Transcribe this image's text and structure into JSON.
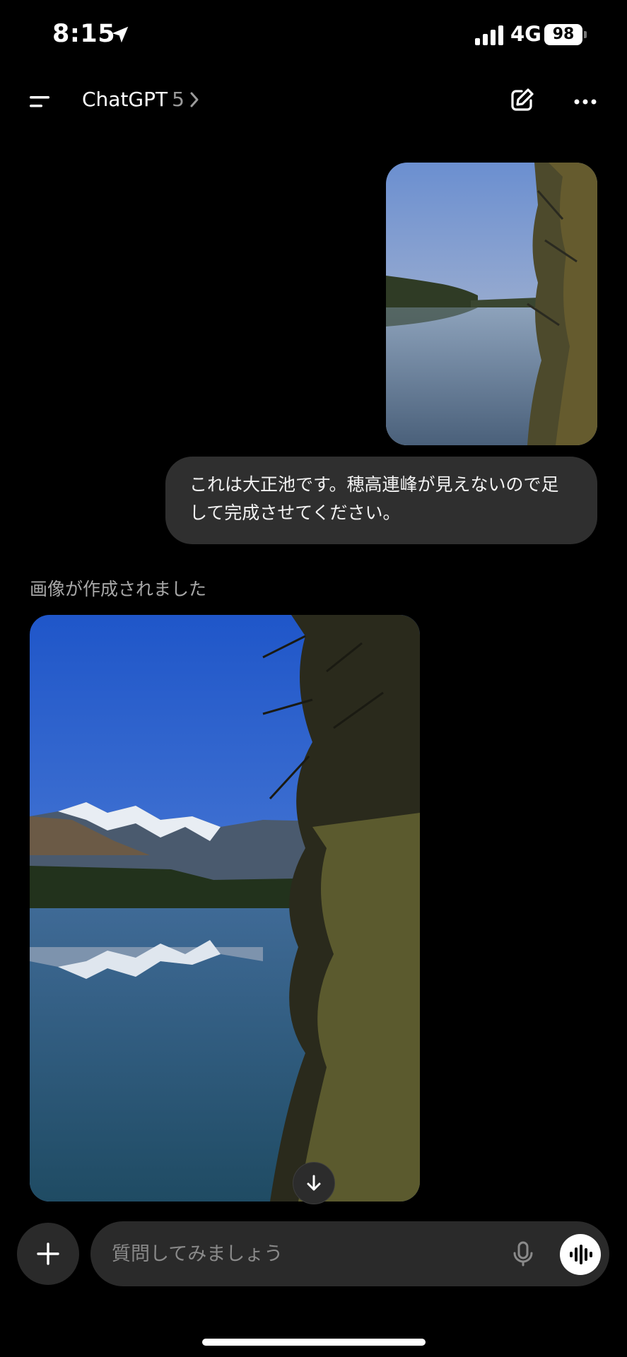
{
  "status_bar": {
    "time": "8:15",
    "network": "4G",
    "battery": "98",
    "icons": [
      "location-arrow-icon",
      "signal-icon",
      "battery-icon"
    ]
  },
  "header": {
    "title": "ChatGPT",
    "model": "5",
    "icons": [
      "menu-icon",
      "chevron-right-icon",
      "edit-icon",
      "more-icon"
    ]
  },
  "conversation": {
    "user_message": "これは大正池です。穂高連峰が見えないので足して完成させてください。",
    "assistant_status": "画像が作成されました"
  },
  "composer": {
    "placeholder": "質問してみましょう",
    "icons": [
      "plus-icon",
      "mic-icon",
      "voice-waveform-icon"
    ]
  },
  "colors": {
    "background": "#000000",
    "bubble": "#2f2f2f",
    "composer": "#2a2a2a",
    "muted_text": "#a8a8a8"
  }
}
